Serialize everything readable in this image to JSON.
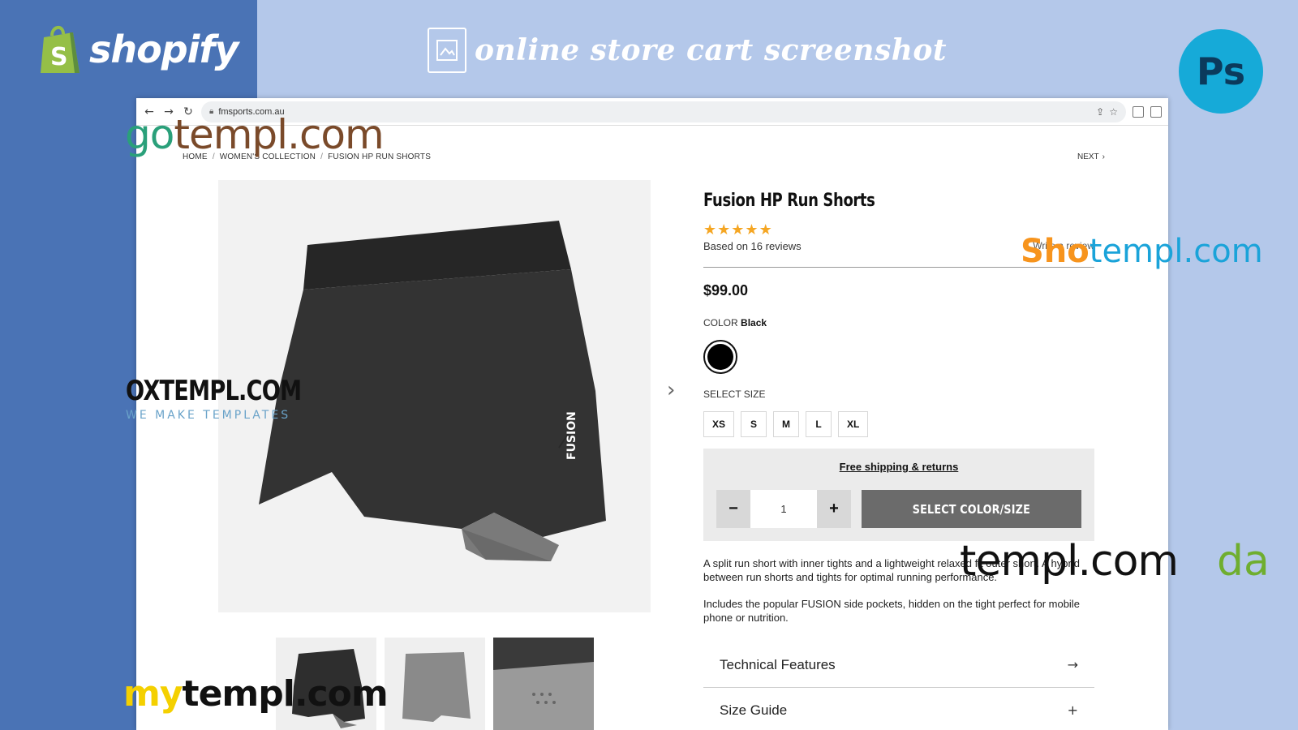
{
  "banner": {
    "brand": "shopify",
    "title": "online store cart screenshot",
    "ps_label": "Ps",
    "colors": {
      "left_panel": "#4a73b5",
      "right_panel": "#b4c8ea",
      "shopify_green": "#95bf47",
      "ps_blue": "#16aad8"
    }
  },
  "browser": {
    "url": "fmsports.com.au",
    "icons": [
      "back-icon",
      "forward-icon",
      "reload-icon",
      "lock-icon",
      "share-icon",
      "star-icon",
      "qr-icon",
      "extension-icon"
    ]
  },
  "breadcrumb": {
    "items": [
      "HOME",
      "WOMEN'S COLLECTION",
      "FUSION HP RUN SHORTS"
    ],
    "separator": "/"
  },
  "next_label": "NEXT",
  "product": {
    "title": "Fusion HP Run Shorts",
    "rating": 5,
    "rating_max": 5,
    "reviews_text": "Based on 16 reviews",
    "write_review": "Write a review",
    "price": "$99.00",
    "color_label": "COLOR",
    "color_value": "Black",
    "size_label": "SELECT SIZE",
    "sizes": [
      "XS",
      "S",
      "M",
      "L",
      "XL"
    ],
    "brand_text": "FUSION"
  },
  "cart": {
    "free_shipping": "Free shipping & returns",
    "quantity": "1",
    "minus": "−",
    "plus": "+",
    "button": "SELECT COLOR/SIZE"
  },
  "description": {
    "p1": "A split run short with inner tights and a lightweight relaxed fit outer short. A hybrid between run shorts and tights for optimal running performance.",
    "p2": "Includes the popular FUSION side pockets, hidden on the tight perfect for mobile phone or nutrition."
  },
  "accordion": [
    {
      "label": "Technical Features",
      "icon": "→"
    },
    {
      "label": "Size Guide",
      "icon": "+"
    }
  ],
  "watermarks": {
    "gotempl": [
      "go",
      "templ.com"
    ],
    "shotempl": [
      "Sho",
      "templ.com"
    ],
    "oxtempl": [
      "OXTEMPL.COM",
      "WE MAKE TEMPLATES"
    ],
    "templ": "templ.com",
    "da": "da",
    "mytempl": [
      "my",
      "templ.com"
    ]
  }
}
